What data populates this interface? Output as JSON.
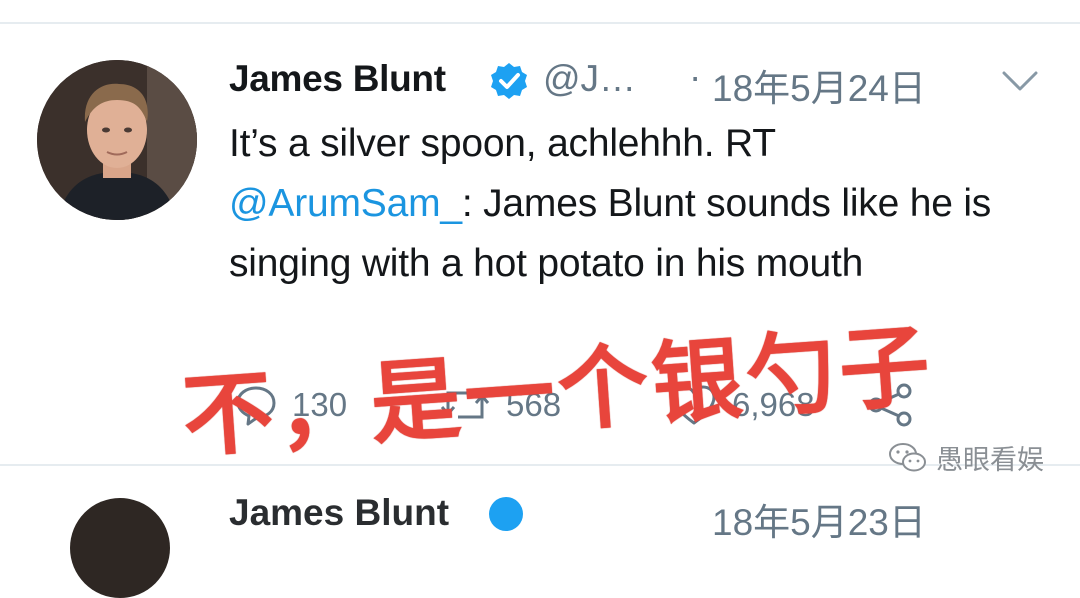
{
  "tweet": {
    "author_name": "James Blunt",
    "handle": "@J…",
    "separator": "·",
    "date": "18年5月24日",
    "text_before": "It’s a silver spoon, achlehhh. RT ",
    "mention": "@ArumSam_",
    "text_after": ": James Blunt sounds like he is singing with a hot potato in his mouth",
    "replies": "130",
    "retweets": "568",
    "likes": "6,968"
  },
  "overlay_caption": "不，是一个银勺子",
  "watermark": "愚眼看娱",
  "next_tweet": {
    "author_name": "James Blunt",
    "date": "18年5月23日"
  },
  "colors": {
    "link": "#1b95e0",
    "secondary": "#657786",
    "verified": "#1da1f2",
    "overlay": "#e8453c"
  }
}
